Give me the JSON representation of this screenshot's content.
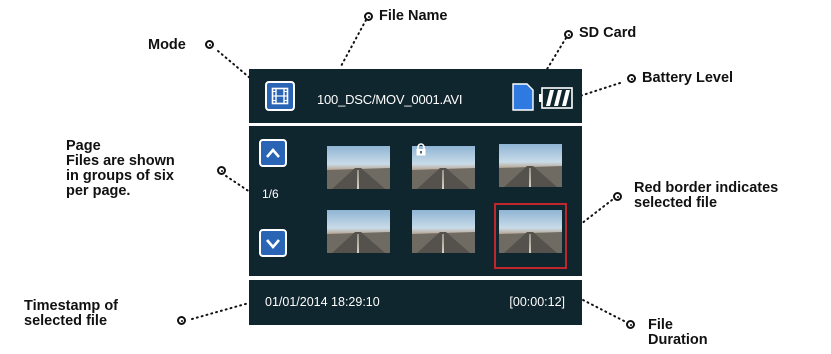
{
  "screen": {
    "mode_icon": "film-icon",
    "file_name": "100_DSC/MOV_0001.AVI",
    "sd_icon": "sd-card-icon",
    "battery_icon": "battery-icon",
    "page_indicator": "1/6",
    "timestamp": "01/01/2014 18:29:10",
    "duration": "[00:00:12]",
    "locked_thumbnail": 1,
    "selected_thumbnail": 5,
    "thumbnail_count": 6
  },
  "callouts": {
    "mode": "Mode",
    "file_name": "File Name",
    "sd_card": "SD Card",
    "battery_level": "Battery Level",
    "page_title": "Page",
    "page_desc_1": "Files are shown",
    "page_desc_2": "in groups of six",
    "page_desc_3": "per page.",
    "red_border_1": "Red border indicates",
    "red_border_2": "selected file",
    "timestamp_1": "Timestamp of",
    "timestamp_2": "selected file",
    "duration_1": "File",
    "duration_2": "Duration"
  },
  "colors": {
    "screen_bg": "#10262f",
    "button_blue": "#2a64b5",
    "selection_red": "#c0272d"
  }
}
